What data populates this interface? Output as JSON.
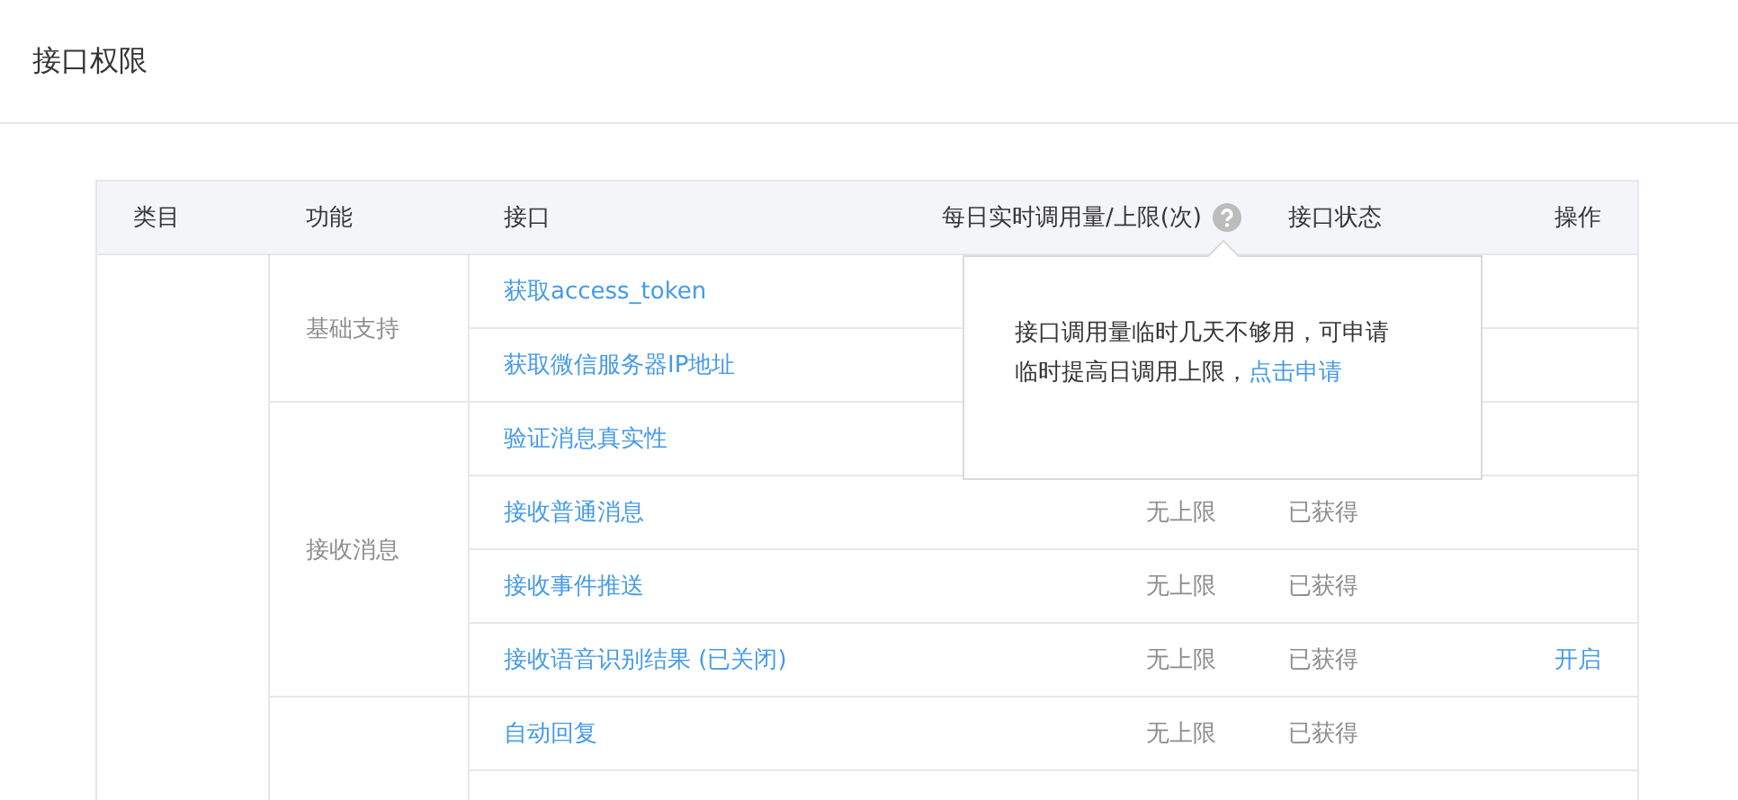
{
  "page_title": "接口权限",
  "table": {
    "columns": [
      "类目",
      "功能",
      "接口",
      "每日实时调用量/上限(次)",
      "接口状态",
      "操作"
    ],
    "groups": [
      {
        "function": "基础支持",
        "rows": [
          {
            "name": "获取access_token"
          },
          {
            "name": "获取微信服务器IP地址"
          }
        ]
      },
      {
        "function": "接收消息",
        "rows": [
          {
            "name": "验证消息真实性"
          },
          {
            "name": "接收普通消息",
            "quota": "无上限",
            "status": "已获得"
          },
          {
            "name": "接收事件推送",
            "quota": "无上限",
            "status": "已获得"
          },
          {
            "name": "接收语音识别结果 (已关闭)",
            "quota": "无上限",
            "status": "已获得",
            "action": "开启"
          }
        ]
      },
      {
        "rows": [
          {
            "name": "自动回复",
            "quota": "无上限",
            "status": "已获得"
          }
        ]
      }
    ]
  },
  "tooltip": {
    "text": "接口调用量临时几天不够用，可申请临时提高日调用上限，",
    "link": "点击申请"
  }
}
